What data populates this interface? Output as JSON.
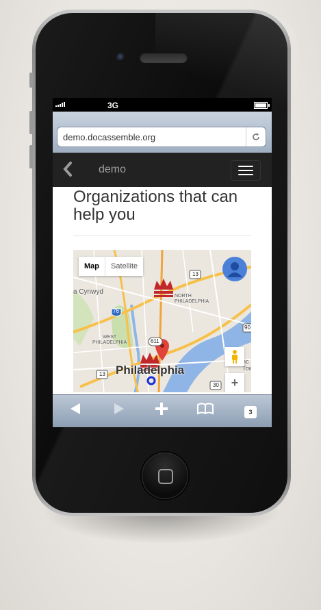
{
  "statusbar": {
    "network": "3G"
  },
  "browser": {
    "url": "demo.docassemble.org",
    "reload_icon": "reload-icon"
  },
  "navbar": {
    "back_icon": "chevron-left-icon",
    "brand": "demo",
    "menu_icon": "hamburger-menu-icon"
  },
  "page": {
    "title": "Organizations that can help you"
  },
  "map": {
    "toggle_map": "Map",
    "toggle_satellite": "Satellite",
    "city": "Philadelphia",
    "zoom_in": "+",
    "labels": {
      "cynwyd": "a Cynwyd",
      "north_philadelphia": "NORTH\nPHILADELPHIA",
      "west_philadelphia": "WEST\nPHILADELPHIA",
      "route_13_top": "13",
      "route_76": "76",
      "route_611": "611",
      "route_13_bottom": "13",
      "route_30": "30",
      "route_90": "90",
      "town_partial": "nc\nTow"
    }
  },
  "toolbar": {
    "back_icon": "back-arrow-icon",
    "forward_icon": "forward-arrow-icon",
    "add_icon": "plus-icon",
    "bookmarks_icon": "bookmarks-icon",
    "tabs_count": "3"
  },
  "colors": {
    "navbar_bg": "#222222",
    "crown_red": "#c0282b",
    "marker_red": "#e0433a",
    "marker_blue": "#1a2dd9"
  }
}
